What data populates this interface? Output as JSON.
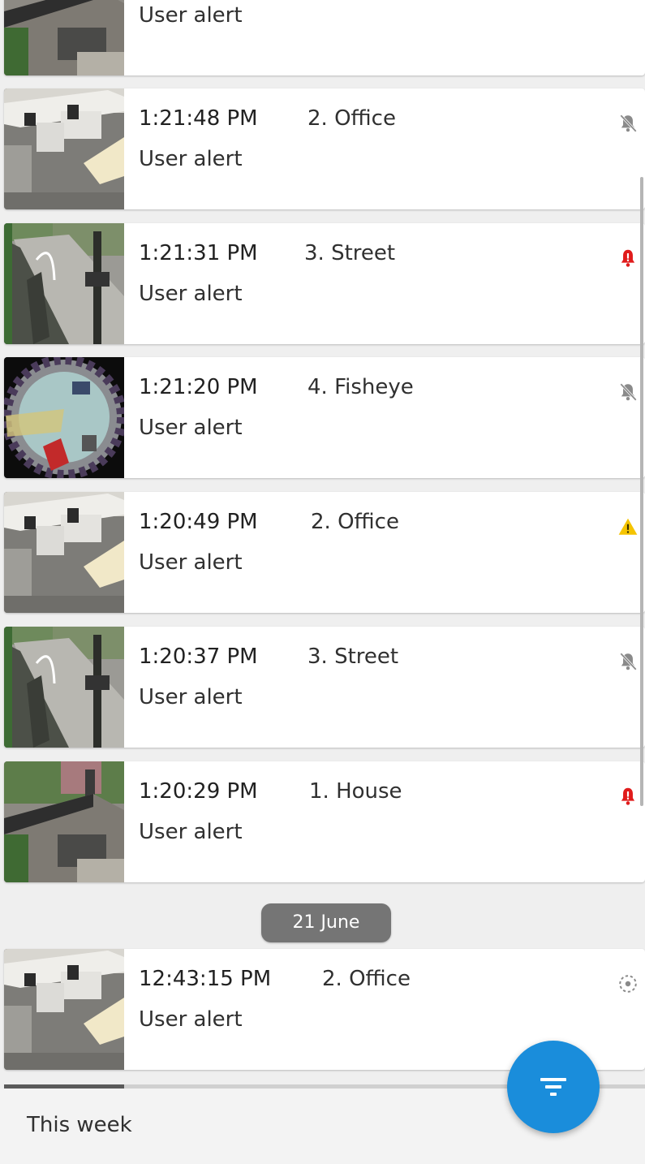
{
  "events": [
    {
      "time": "",
      "camera": "",
      "type": "User alert",
      "status": "none",
      "thumb": "house"
    },
    {
      "time": "1:21:48 PM",
      "camera": "2. Office",
      "type": "User alert",
      "status": "muted",
      "thumb": "office"
    },
    {
      "time": "1:21:31 PM",
      "camera": "3. Street",
      "type": "User alert",
      "status": "alarm",
      "thumb": "street"
    },
    {
      "time": "1:21:20 PM",
      "camera": "4. Fisheye",
      "type": "User alert",
      "status": "muted",
      "thumb": "fisheye"
    },
    {
      "time": "1:20:49 PM",
      "camera": "2. Office",
      "type": "User alert",
      "status": "warning",
      "thumb": "office"
    },
    {
      "time": "1:20:37 PM",
      "camera": "3. Street",
      "type": "User alert",
      "status": "muted",
      "thumb": "street"
    },
    {
      "time": "1:20:29 PM",
      "camera": "1. House",
      "type": "User alert",
      "status": "alarm",
      "thumb": "house"
    }
  ],
  "date_divider": "21 June",
  "events_after": [
    {
      "time": "12:43:15 PM",
      "camera": "2. Office",
      "type": "User alert",
      "status": "motion",
      "thumb": "office"
    }
  ],
  "bottom_bar": {
    "period_label": "This week"
  },
  "fab": {
    "icon": "filter-icon",
    "color": "#1a8ddb"
  },
  "colors": {
    "alarm": "#e01b1b",
    "warning": "#f5c400",
    "muted": "#8a8a8a",
    "background": "#efefef"
  },
  "icons": {
    "muted": "bell-off-icon",
    "alarm": "bell-alarm-icon",
    "warning": "warning-triangle-icon",
    "motion": "motion-dot-icon"
  }
}
